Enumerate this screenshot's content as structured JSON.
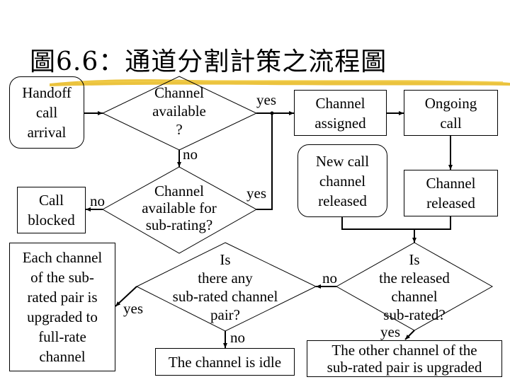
{
  "title": "圖6.6：通道分割計策之流程圖",
  "colors": {
    "highlight": "#e8b81c",
    "stroke": "#000000",
    "background": "#ffffff"
  },
  "nodes": {
    "handoff_arrival": "Handoff call arrival",
    "handoff_lines": [
      "Handoff",
      "call",
      "arrival"
    ],
    "decision_available": [
      "Channel",
      "available",
      "?"
    ],
    "call_blocked": [
      "Call",
      "blocked"
    ],
    "decision_subrating": [
      "Channel",
      "available for",
      "sub-rating?"
    ],
    "channel_assigned": [
      "Channel",
      "assigned"
    ],
    "ongoing_call": [
      "Ongoing",
      "call"
    ],
    "new_call_released": [
      "New call",
      "channel",
      "released"
    ],
    "channel_released": [
      "Channel",
      "released"
    ],
    "upgrade_pair": [
      "Each channel",
      "of the sub-",
      "rated pair is",
      "upgraded to",
      "full-rate",
      "channel"
    ],
    "decision_any_subrated": [
      "Is",
      "there any",
      "sub-rated channel",
      "pair?"
    ],
    "channel_idle": "The channel is idle",
    "decision_released_subrated": [
      "Is",
      "the released",
      "channel",
      "sub-rated?"
    ],
    "other_upgraded": [
      "The other channel of the",
      "sub-rated pair is upgraded"
    ]
  },
  "edge_labels": {
    "available_yes": "yes",
    "available_no": "no",
    "subrating_no": "no",
    "subrating_yes": "yes",
    "any_subrated_yes": "yes",
    "any_subrated_no": "no",
    "released_no": "no",
    "released_yes": "yes"
  }
}
